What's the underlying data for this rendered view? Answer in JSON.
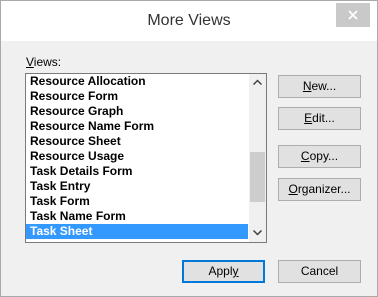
{
  "window": {
    "title": "More Views",
    "close_glyph": "✕"
  },
  "views_label": {
    "mnemonic": "V",
    "rest": "iews:"
  },
  "views_list": {
    "items": [
      "Resource Allocation",
      "Resource Form",
      "Resource Graph",
      "Resource Name Form",
      "Resource Sheet",
      "Resource Usage",
      "Task Details Form",
      "Task Entry",
      "Task Form",
      "Task Name Form",
      "Task Sheet"
    ],
    "selected": "Task Sheet",
    "scroll_position": 0.85
  },
  "side_buttons": {
    "new": {
      "mnemonic": "N",
      "rest": "ew..."
    },
    "edit": {
      "mnemonic": "E",
      "rest": "dit..."
    },
    "copy": {
      "mnemonic": "C",
      "rest": "opy..."
    },
    "organizer": {
      "mnemonic": "O",
      "rest": "rganizer..."
    }
  },
  "footer_buttons": {
    "apply": {
      "before": "Appl",
      "mnemonic": "y"
    },
    "cancel": "Cancel"
  },
  "colors": {
    "selection": "#3399ff",
    "default_button_border": "#0078d7",
    "close_button_bg": "#c9c9c9"
  }
}
